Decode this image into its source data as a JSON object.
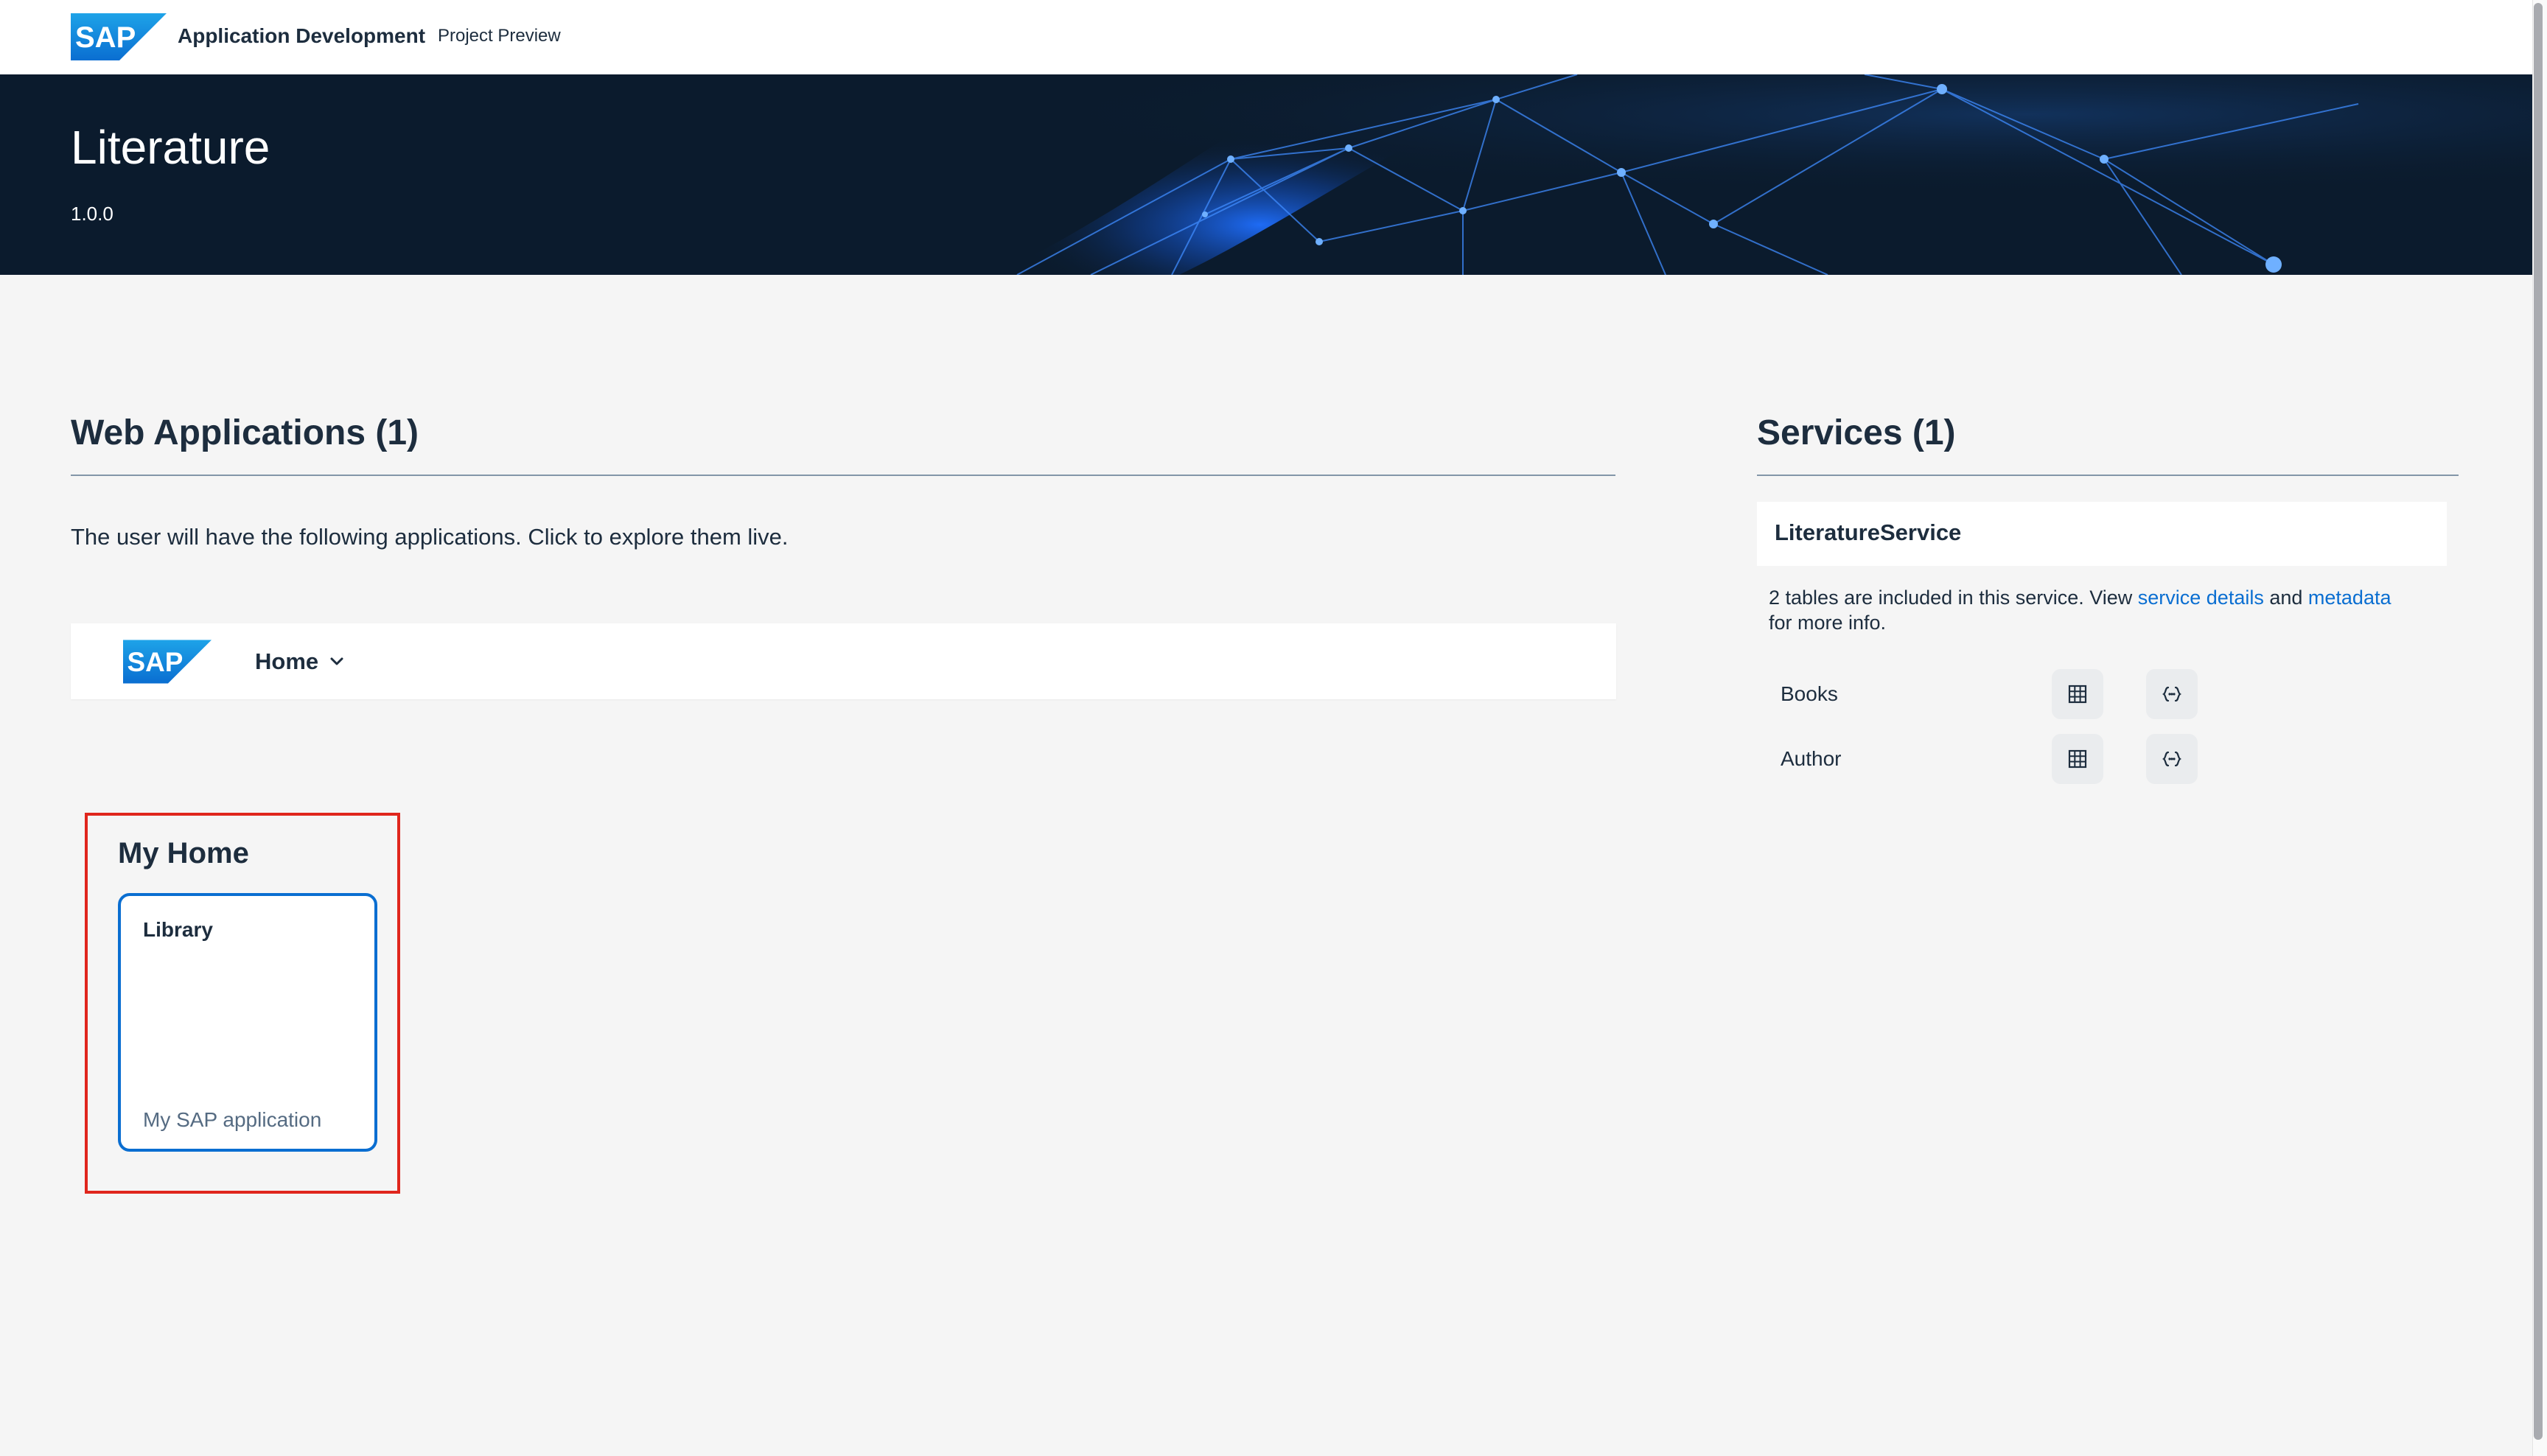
{
  "shell": {
    "logo_text": "SAP",
    "title": "Application Development",
    "subtitle": "Project Preview"
  },
  "hero": {
    "title": "Literature",
    "version": "1.0.0"
  },
  "web_applications": {
    "heading": "Web Applications (1)",
    "description": "The user will have the following applications. Click to explore them live.",
    "app_bar": {
      "logo_text": "SAP",
      "menu_label": "Home",
      "menu_icon": "chevron-down-icon"
    },
    "group": {
      "title": "My Home",
      "tiles": [
        {
          "title": "Library",
          "subtitle": "My SAP application"
        }
      ]
    }
  },
  "services": {
    "heading": "Services (1)",
    "service": {
      "name": "LiteratureService",
      "info_prefix": "2 tables are included in this service. View ",
      "link_details": "service details",
      "info_and": " and ",
      "link_metadata": "metadata",
      "info_suffix": "for more info.",
      "entities": [
        {
          "name": "Books",
          "icons": [
            "table-icon",
            "code-icon"
          ]
        },
        {
          "name": "Author",
          "icons": [
            "table-icon",
            "code-icon"
          ]
        }
      ]
    }
  },
  "colors": {
    "brand_blue": "#0a6ed1",
    "highlight_red": "#e0261d",
    "hero_bg": "#0b1b2d",
    "page_bg": "#f5f5f5"
  }
}
